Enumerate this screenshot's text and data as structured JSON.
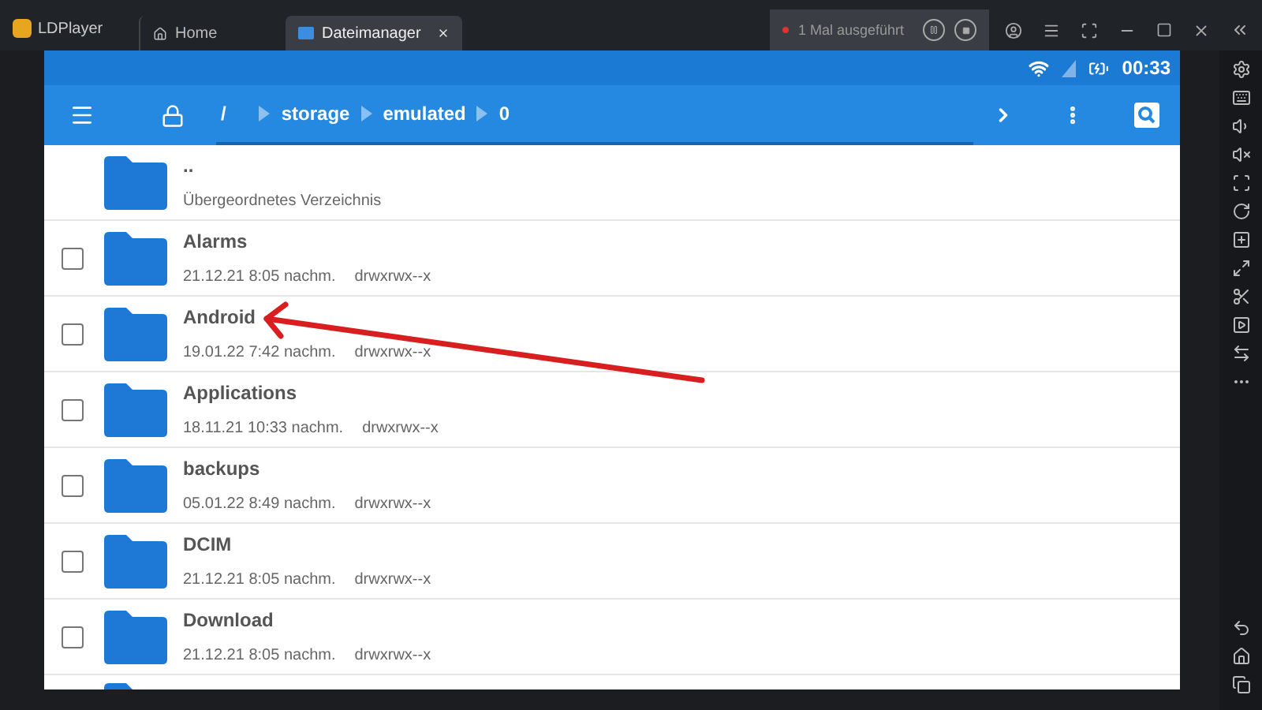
{
  "titlebar": {
    "app_name": "LDPlayer",
    "tabs": [
      {
        "label": "Home",
        "kind": "home",
        "selected": false
      },
      {
        "label": "Dateimanager",
        "kind": "files",
        "selected": true
      }
    ],
    "macro": {
      "label": "1 Mal ausgeführt"
    }
  },
  "status_bar": {
    "time": "00:33"
  },
  "toolbar": {
    "breadcrumb": [
      "/",
      "storage",
      "emulated",
      "0"
    ]
  },
  "files": [
    {
      "name": "..",
      "details": "Übergeordnetes Verzeichnis",
      "kind": "parent"
    },
    {
      "name": "Alarms",
      "date": "21.12.21 8:05 nachm.",
      "permissions": "drwxrwx--x",
      "kind": "folder",
      "checked": false
    },
    {
      "name": "Android",
      "date": "19.01.22 7:42 nachm.",
      "permissions": "drwxrwx--x",
      "kind": "folder",
      "checked": false
    },
    {
      "name": "Applications",
      "date": "18.11.21 10:33 nachm.",
      "permissions": "drwxrwx--x",
      "kind": "folder",
      "checked": false
    },
    {
      "name": "backups",
      "date": "05.01.22 8:49 nachm.",
      "permissions": "drwxrwx--x",
      "kind": "folder",
      "checked": false
    },
    {
      "name": "DCIM",
      "date": "21.12.21 8:05 nachm.",
      "permissions": "drwxrwx--x",
      "kind": "folder",
      "checked": false
    },
    {
      "name": "Download",
      "date": "21.12.21 8:05 nachm.",
      "permissions": "drwxrwx--x",
      "kind": "folder",
      "checked": false
    },
    {
      "kind": "partial"
    }
  ]
}
